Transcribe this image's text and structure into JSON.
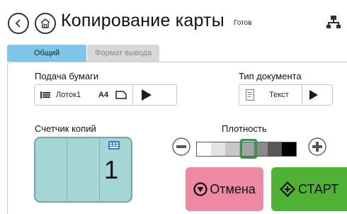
{
  "header": {
    "title": "Копирование карты",
    "status": "Готов"
  },
  "tabs": [
    {
      "label": "Общий",
      "active": true
    },
    {
      "label": "Формат вывода",
      "active": false
    }
  ],
  "paper_feed": {
    "label": "Подача бумаги",
    "tray": "Лоток1",
    "size": "A4"
  },
  "document_type": {
    "label": "Тип документа",
    "value": "Текст"
  },
  "copies": {
    "label": "Счетчик копий",
    "value": "1"
  },
  "density": {
    "label": "Плотность",
    "levels": 7,
    "selected_level": 4,
    "colors": [
      "#ffffff",
      "#e3e3e3",
      "#c7c7c7",
      "#a4a4a4",
      "#8a8a8a",
      "#575757",
      "#000000"
    ],
    "selected_color": "#2f9a3e"
  },
  "actions": {
    "cancel": "Отмена",
    "start": "СТАРТ",
    "cancel_color": "#ee89a3",
    "start_color": "#4fb234"
  },
  "icons": {
    "back": "chevron-left-icon",
    "home": "home-icon",
    "network": "network-icon",
    "tray": "paper-tray-icon",
    "orientation": "portrait-orientation-icon",
    "document": "document-icon",
    "keypad": "keypad-icon",
    "stop": "stop-icon",
    "start": "start-icon"
  }
}
